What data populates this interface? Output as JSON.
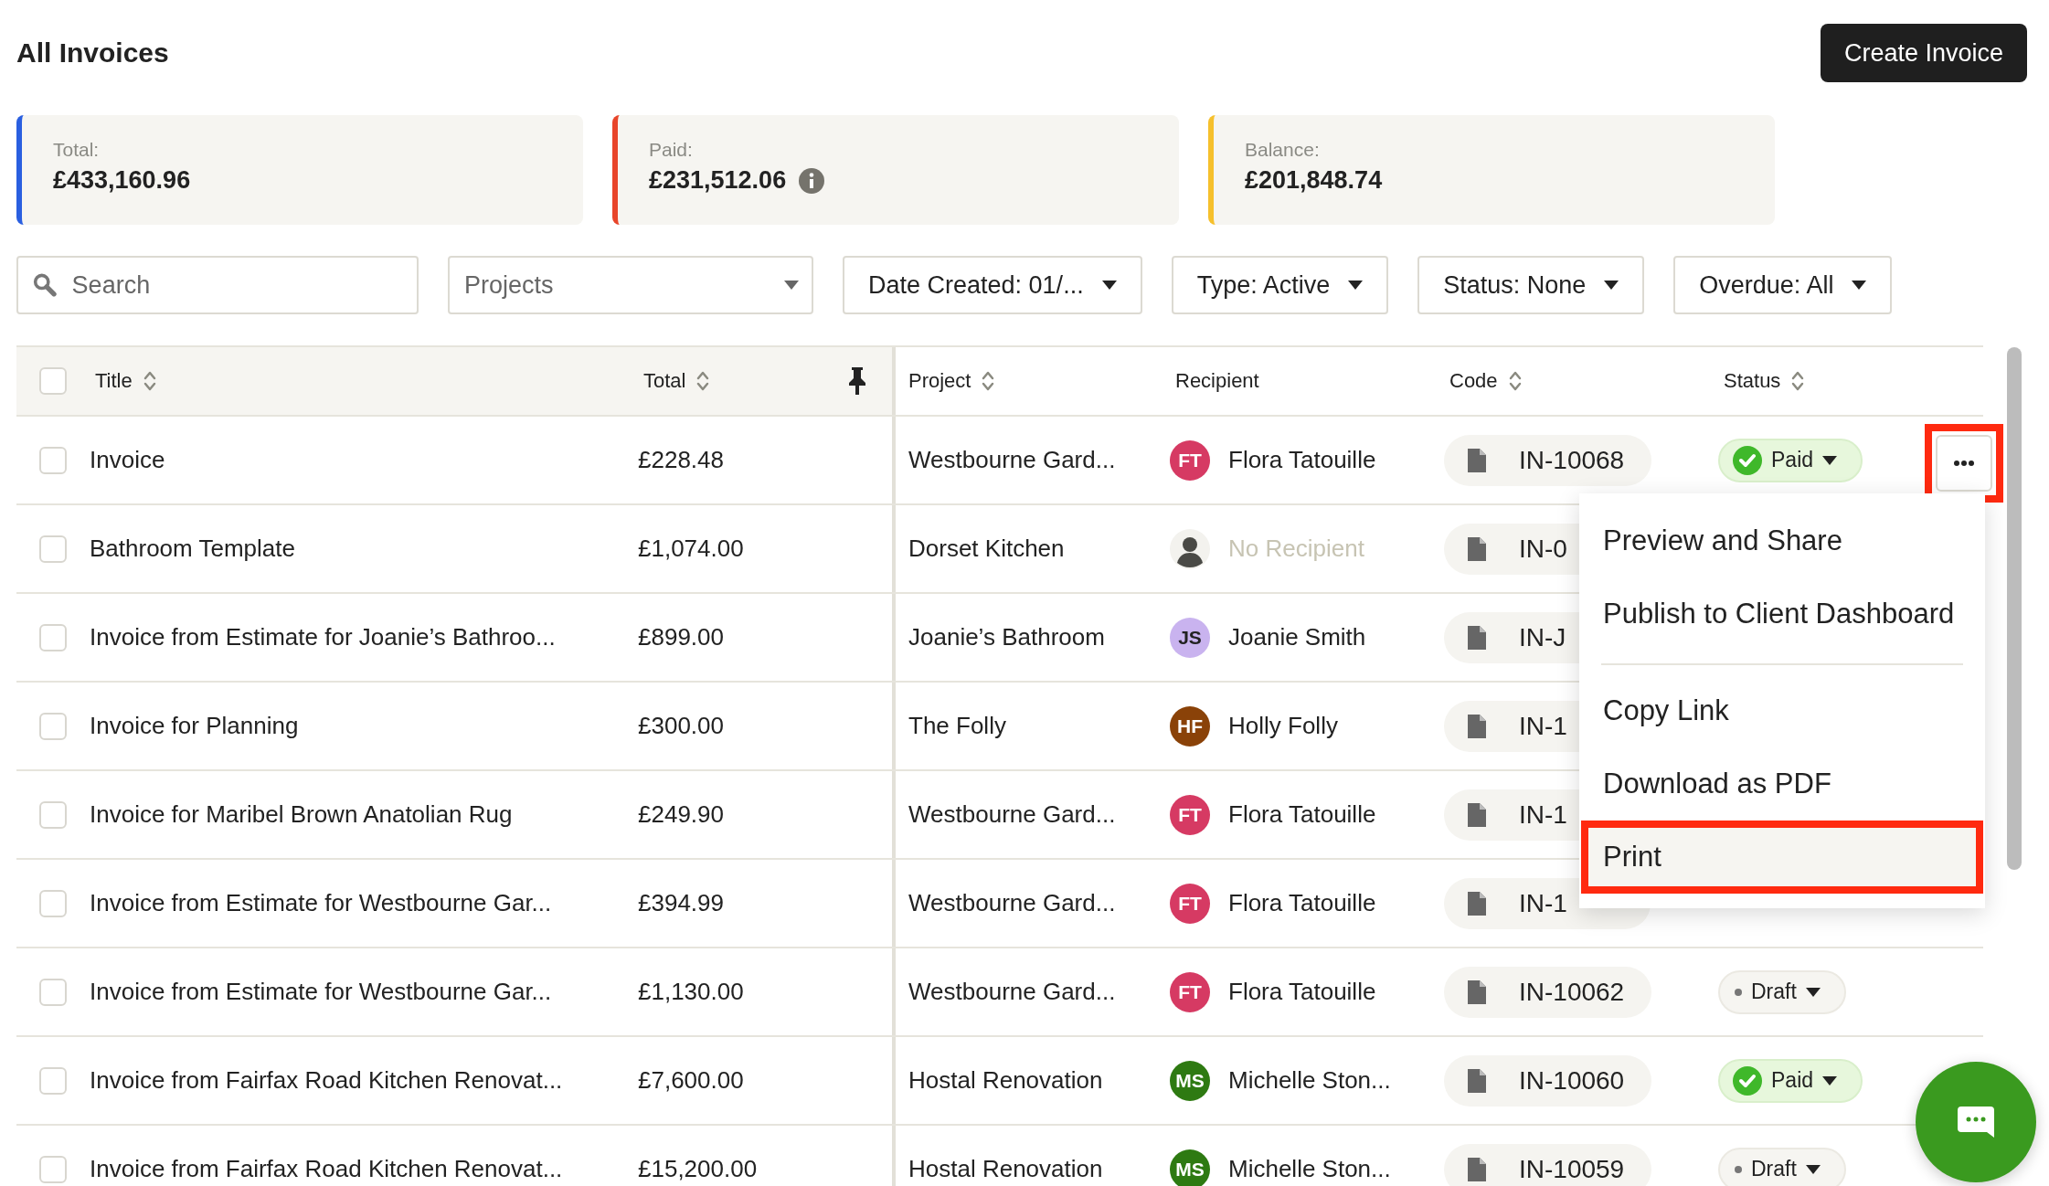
{
  "page": {
    "title": "All Invoices",
    "create_button": "Create Invoice"
  },
  "summary": [
    {
      "label": "Total:",
      "value": "£433,160.96",
      "color": "#2a5fe0",
      "info": false
    },
    {
      "label": "Paid:",
      "value": "£231,512.06",
      "color": "#e8452a",
      "info": true
    },
    {
      "label": "Balance:",
      "value": "£201,848.74",
      "color": "#f6c02c",
      "info": false
    }
  ],
  "filters": [
    {
      "kind": "search",
      "placeholder": "Search"
    },
    {
      "kind": "select",
      "placeholder": "Projects"
    },
    {
      "kind": "menu",
      "label": "Date Created: 01/..."
    },
    {
      "kind": "menu",
      "label": "Type: Active"
    },
    {
      "kind": "menu",
      "label": "Status: None"
    },
    {
      "kind": "menu",
      "label": "Overdue: All"
    }
  ],
  "table": {
    "select_all_checked": false,
    "columns": [
      {
        "label": "Title",
        "sortable": true
      },
      {
        "label": "Total",
        "sortable": true,
        "pinned": true
      },
      {
        "label": "Project",
        "sortable": true
      },
      {
        "label": "Recipient",
        "sortable": false
      },
      {
        "label": "Code",
        "sortable": true
      },
      {
        "label": "Status",
        "sortable": true
      }
    ],
    "rows": [
      {
        "checked": false,
        "title": "Invoice",
        "total": "£228.48",
        "project": "Westbourne Gard...",
        "recipient": {
          "kind": "person",
          "initials": "FT",
          "name": "Flora Tatouille",
          "color": "#d63a63"
        },
        "code": "IN-10068",
        "status": {
          "kind": "paid",
          "label": "Paid"
        },
        "more_button": {
          "highlighted": true
        }
      },
      {
        "checked": false,
        "title": "Bathroom Template",
        "total": "£1,074.00",
        "project": "Dorset Kitchen",
        "recipient": {
          "kind": "none",
          "name": "No Recipient"
        },
        "code": "IN-0"
      },
      {
        "checked": false,
        "title": "Invoice from Estimate for Joanie’s Bathroo...",
        "total": "£899.00",
        "project": "Joanie’s Bathroom",
        "recipient": {
          "kind": "person",
          "initials": "JS",
          "name": "Joanie Smith",
          "color": "#c9b3ef"
        },
        "code": "IN-J"
      },
      {
        "checked": false,
        "title": "Invoice for Planning",
        "total": "£300.00",
        "project": "The Folly",
        "recipient": {
          "kind": "person",
          "initials": "HF",
          "name": "Holly Folly",
          "color": "#8a4208"
        },
        "code": "IN-1"
      },
      {
        "checked": false,
        "title": "Invoice for Maribel Brown Anatolian Rug",
        "total": "£249.90",
        "project": "Westbourne Gard...",
        "recipient": {
          "kind": "person",
          "initials": "FT",
          "name": "Flora Tatouille",
          "color": "#d63a63"
        },
        "code": "IN-1"
      },
      {
        "checked": false,
        "title": "Invoice from Estimate for Westbourne Gar...",
        "total": "£394.99",
        "project": "Westbourne Gard...",
        "recipient": {
          "kind": "person",
          "initials": "FT",
          "name": "Flora Tatouille",
          "color": "#d63a63"
        },
        "code": "IN-1"
      },
      {
        "checked": false,
        "title": "Invoice from Estimate for Westbourne Gar...",
        "total": "£1,130.00",
        "project": "Westbourne Gard...",
        "recipient": {
          "kind": "person",
          "initials": "FT",
          "name": "Flora Tatouille",
          "color": "#d63a63"
        },
        "code": "IN-10062",
        "status": {
          "kind": "draft",
          "label": "Draft"
        }
      },
      {
        "checked": false,
        "title": "Invoice from Fairfax Road Kitchen Renovat...",
        "total": "£7,600.00",
        "project": "Hostal Renovation",
        "recipient": {
          "kind": "person",
          "initials": "MS",
          "name": "Michelle Ston...",
          "color": "#2e7a12"
        },
        "code": "IN-10060",
        "status": {
          "kind": "paid",
          "label": "Paid"
        }
      },
      {
        "checked": false,
        "title": "Invoice from Fairfax Road Kitchen Renovat...",
        "total": "£15,200.00",
        "project": "Hostal Renovation",
        "recipient": {
          "kind": "person",
          "initials": "MS",
          "name": "Michelle Ston...",
          "color": "#2e7a12"
        },
        "code": "IN-10059",
        "status": {
          "kind": "draft",
          "label": "Draft"
        }
      }
    ]
  },
  "row_menu": {
    "items": [
      {
        "kind": "item",
        "label": "Preview and Share",
        "highlighted": false
      },
      {
        "kind": "item",
        "label": "Publish to Client Dashboard",
        "highlighted": false
      },
      {
        "kind": "divider"
      },
      {
        "kind": "item",
        "label": "Copy Link",
        "highlighted": false
      },
      {
        "kind": "item",
        "label": "Download as PDF",
        "highlighted": false
      },
      {
        "kind": "item",
        "label": "Print",
        "highlighted": true
      }
    ]
  }
}
